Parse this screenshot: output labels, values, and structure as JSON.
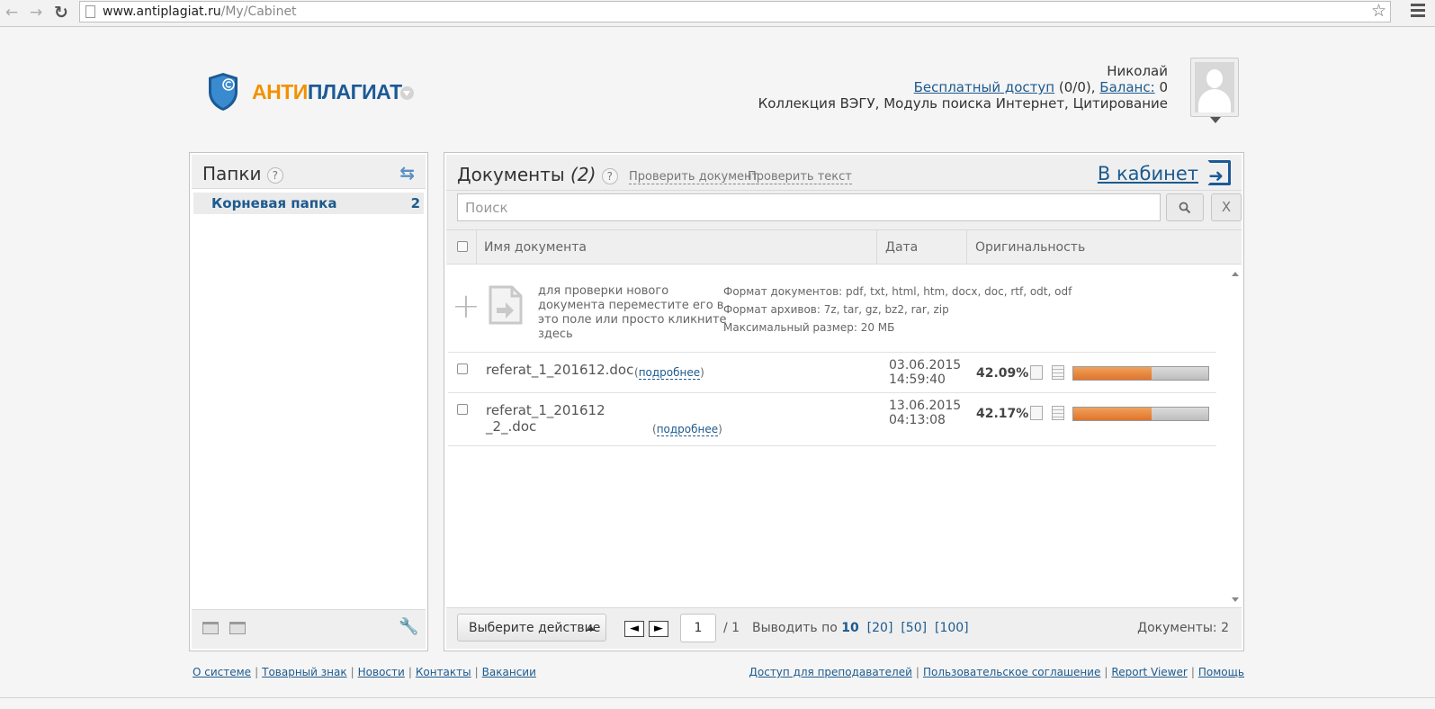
{
  "browser": {
    "url_host": "www.antiplagiat.ru",
    "url_path": "/My/Cabinet"
  },
  "header": {
    "logo_anti": "АНТИ",
    "logo_plagiat": "ПЛАГИАТ",
    "user_name": "Николай",
    "free_access_label": "Бесплатный доступ",
    "free_access_count": "(0/0),",
    "balance_label": "Баланс:",
    "balance_value": "0",
    "collections": "Коллекция ВЭГУ, Модуль поиска Интернет, Цитирование"
  },
  "folders": {
    "title": "Папки",
    "help": "?",
    "items": [
      {
        "name": "Корневая папка",
        "count": "2"
      }
    ]
  },
  "documents": {
    "title": "Документы",
    "count": "(2)",
    "help": "?",
    "check_document": "Проверить документ",
    "check_text": "Проверить текст",
    "cabinet_link": "В кабинет",
    "search_placeholder": "Поиск",
    "clear_label": "X",
    "columns": {
      "name": "Имя документа",
      "date": "Дата",
      "originality": "Оригинальность"
    },
    "drop_zone": {
      "text": "для проверки нового документа переместите его в это поле или просто кликните здесь",
      "formats": "Формат документов: pdf, txt, html, htm, docx, doc, rtf, odt, odf",
      "archives": "Формат архивов: 7z, tar, gz, bz2, rar, zip",
      "max_size": "Максимальный размер: 20 МБ"
    },
    "rows": [
      {
        "name_line1": "referat_1_201612.doc",
        "name_line2": "",
        "more": "подробнее",
        "date": "03.06.2015",
        "time": "14:59:40",
        "originality": "42.09%",
        "originality_fraction": 0.58
      },
      {
        "name_line1": "referat_1_201612",
        "name_line2": "_2_.doc",
        "more": "подробнее",
        "date": "13.06.2015",
        "time": "04:13:08",
        "originality": "42.17%",
        "originality_fraction": 0.58
      }
    ],
    "footer": {
      "action_label": "Выберите действие",
      "page": "1",
      "page_total": "/ 1",
      "per_page_label": "Выводить по",
      "per_page_current": "10",
      "per_page_options": [
        "[20]",
        "[50]",
        "[100]"
      ],
      "docs_total": "Документы: 2"
    }
  },
  "footer": {
    "left": [
      "О системе",
      "Товарный знак",
      "Новости",
      "Контакты",
      "Вакансии"
    ],
    "right": [
      "Доступ для преподавателей",
      "Пользовательское соглашение",
      "Report Viewer",
      "Помощь"
    ]
  },
  "colors": {
    "brand_orange": "#f29100",
    "brand_blue": "#1c5a96",
    "bar_fill": "#e8873f"
  }
}
